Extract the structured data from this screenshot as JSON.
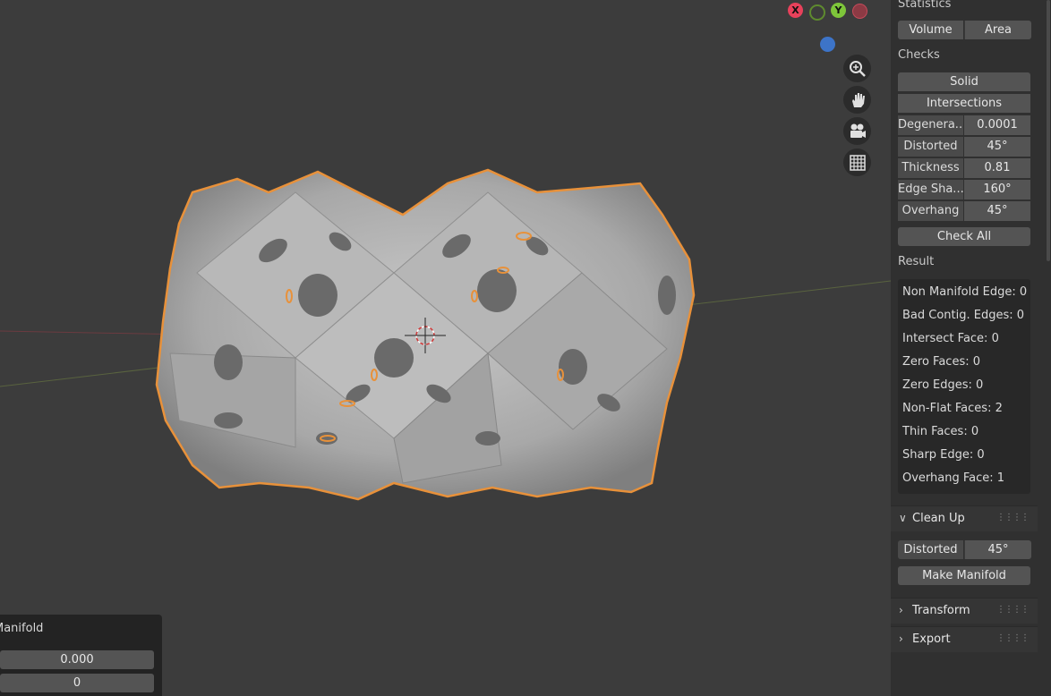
{
  "viewport": {
    "gizmo": {
      "x_label": "X",
      "y_label": "Y"
    },
    "op_panel": {
      "title": "Manifold",
      "value1": "0.000",
      "value2": "0"
    }
  },
  "sidebar": {
    "statistics": {
      "title": "Statistics",
      "volume": "Volume",
      "area": "Area"
    },
    "checks": {
      "title": "Checks",
      "solid": "Solid",
      "intersections": "Intersections",
      "rows": [
        {
          "label": "Degenera...",
          "value": "0.0001"
        },
        {
          "label": "Distorted",
          "value": "45°"
        },
        {
          "label": "Thickness",
          "value": "0.81"
        },
        {
          "label": "Edge Sha...",
          "value": "160°"
        },
        {
          "label": "Overhang",
          "value": "45°"
        }
      ],
      "check_all": "Check All"
    },
    "result": {
      "title": "Result",
      "lines": [
        "Non Manifold Edge: 0",
        "Bad Contig. Edges: 0",
        "Intersect Face: 0",
        "Zero Faces: 0",
        "Zero Edges: 0",
        "Non-Flat Faces: 2",
        "Thin Faces: 0",
        "Sharp Edge: 0",
        "Overhang Face: 1"
      ]
    },
    "cleanup": {
      "title": "Clean Up",
      "distorted_label": "Distorted",
      "distorted_value": "45°",
      "make_manifold": "Make Manifold"
    },
    "transform": {
      "title": "Transform"
    },
    "export": {
      "title": "Export"
    }
  },
  "colors": {
    "background": "#3c3c3c",
    "selection_outline": "#e8913a",
    "x_axis": "#e8415b",
    "y_axis": "#7ec63a",
    "z_axis": "#3d74c8"
  }
}
